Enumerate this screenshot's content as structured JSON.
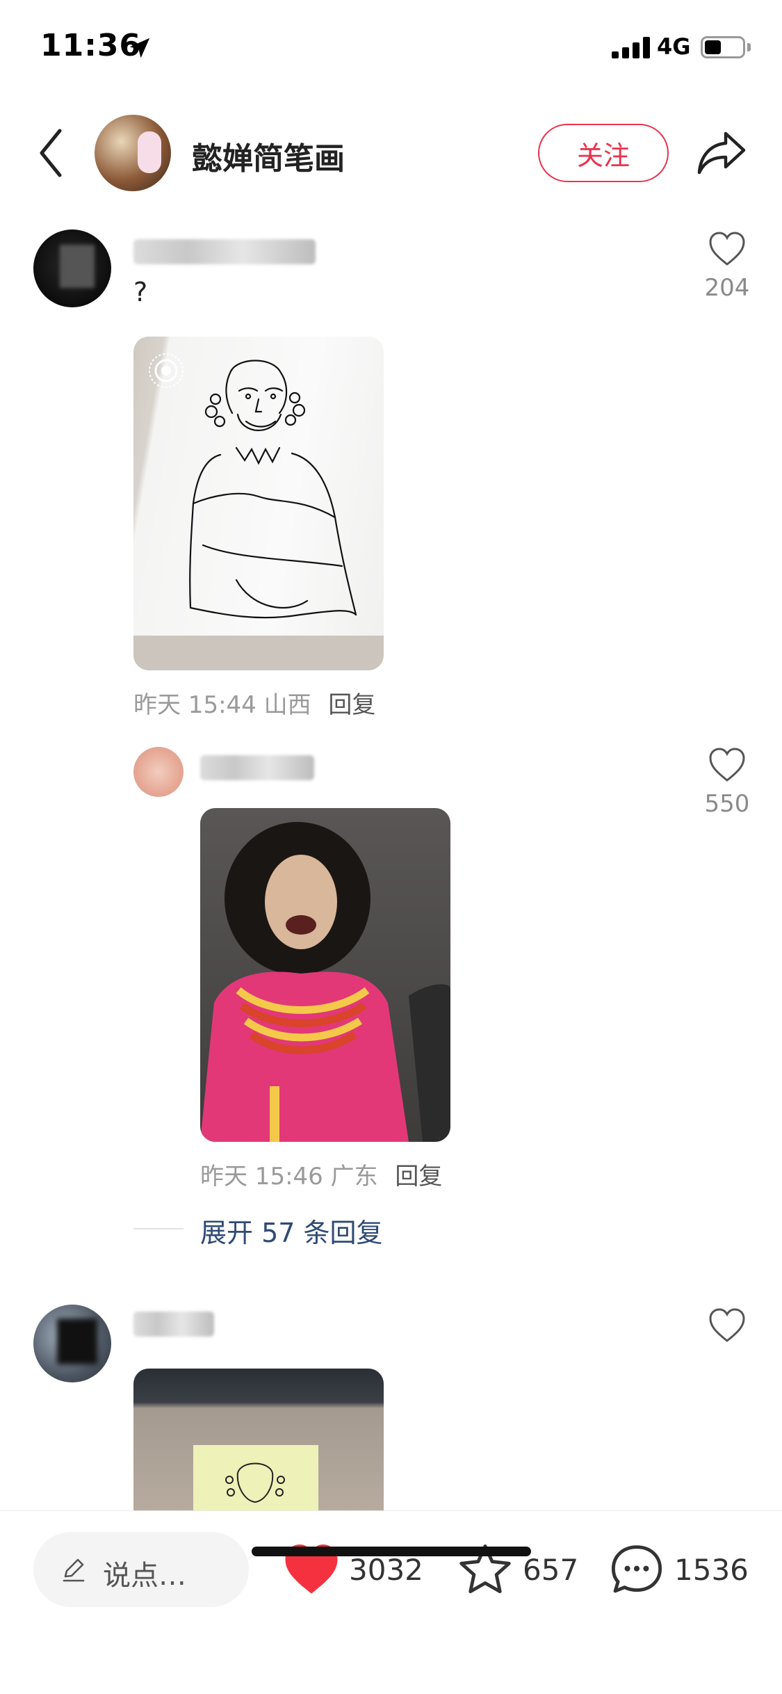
{
  "status_bar": {
    "time": "11:36",
    "network": "4G",
    "battery_level": 0.45
  },
  "header": {
    "title": "懿婵简笔画",
    "follow_label": "关注"
  },
  "comments": [
    {
      "username": "▪▪▪▪▪▪▪▪▪▪▪▪▪▪▪",
      "text": "?",
      "like_count": "204",
      "meta": "昨天 15:44 山西",
      "reply_label": "回复"
    },
    {
      "username": "▪▪▪▪▪▪▪▪▪",
      "text": "",
      "like_count": "550",
      "meta": "昨天 15:46 广东",
      "reply_label": "回复"
    },
    {
      "username": "▪▪▪▪▪",
      "text": "",
      "like_count": "",
      "meta": "",
      "reply_label": ""
    }
  ],
  "expand_replies": "展开 57 条回复",
  "bottom_bar": {
    "input_placeholder": "说点…",
    "likes": "3032",
    "favorites": "657",
    "comments": "1536"
  },
  "colors": {
    "accent": "#e8344e",
    "link": "#2f4a75",
    "muted": "#9a9a9a"
  },
  "icons": [
    "back-icon",
    "share-icon",
    "heart-outline-icon",
    "heart-filled-icon",
    "star-icon",
    "comment-bubble-icon",
    "pencil-icon",
    "live-photo-icon",
    "location-arrow-icon",
    "signal-icon",
    "battery-icon"
  ]
}
